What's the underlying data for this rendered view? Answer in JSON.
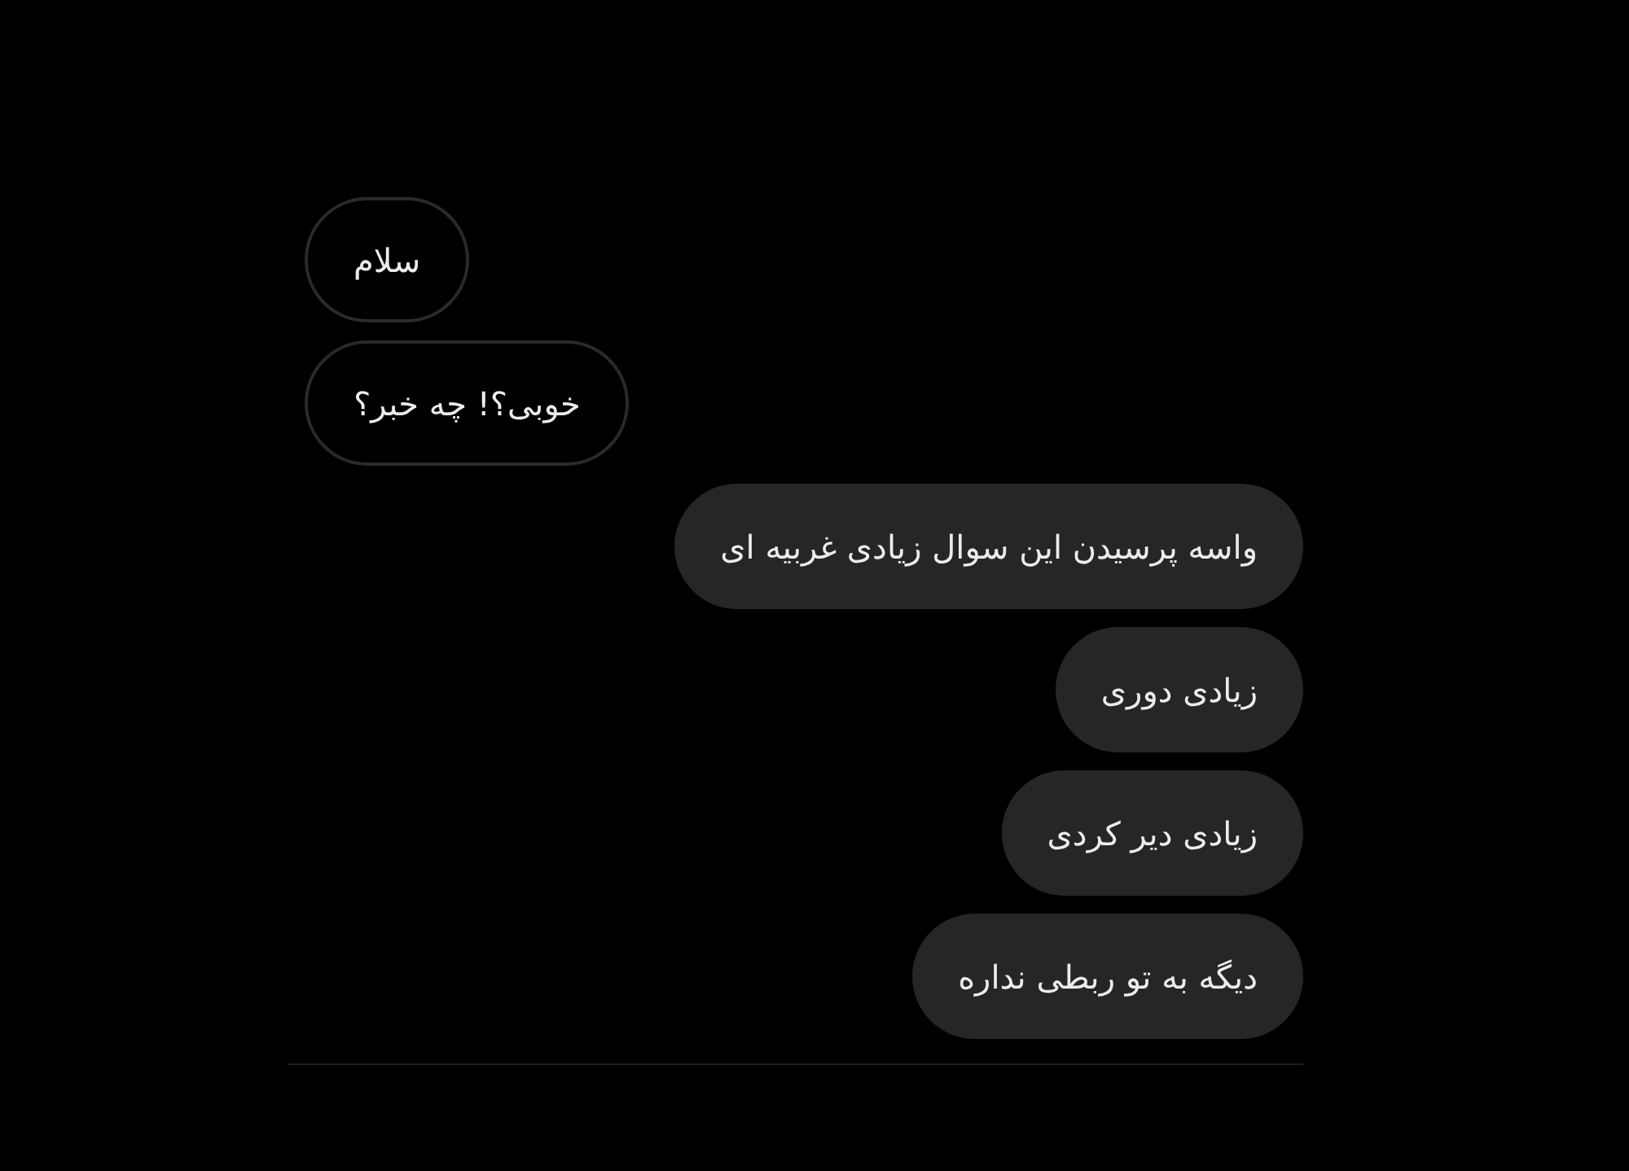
{
  "messages": [
    {
      "kind": "received",
      "text": "سلام"
    },
    {
      "kind": "received",
      "text": "خوبی؟! چه خبر؟"
    },
    {
      "kind": "sent",
      "text": "واسه پرسیدن این سوال زیادی غربیه ای"
    },
    {
      "kind": "sent",
      "text": "زیادی دوری"
    },
    {
      "kind": "sent",
      "text": "زیادی دیر کردی"
    },
    {
      "kind": "sent",
      "text": "دیگه به تو ربطی نداره"
    }
  ]
}
